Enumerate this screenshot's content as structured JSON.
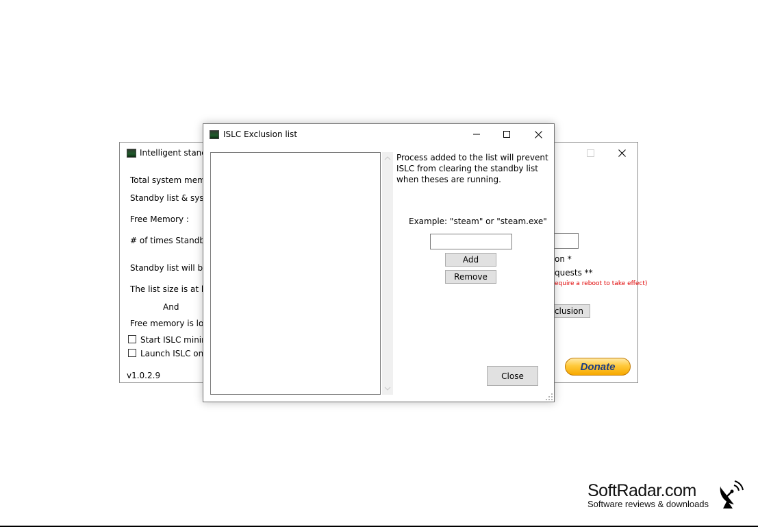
{
  "main_window": {
    "title": "Intelligent standb",
    "labels": {
      "total_memory": "Total system memor",
      "standby_list": "Standby list & syster",
      "free_memory": "Free Memory :",
      "times_standby": "# of times Standby l",
      "standby_will_be": "Standby list will be p",
      "list_size": "The list size is at leas",
      "and": "And",
      "free_lower": "Free memory is lowe",
      "start_minimized": "Start ISLC minimiz",
      "launch_on": "Launch ISLC on u",
      "version": "v1.0.2.9",
      "right_on": "on *",
      "right_requests": "quests **",
      "reboot_note": "equire a reboot to take effect)",
      "exclusion_button": "xclusion",
      "donate": "Donate"
    }
  },
  "dialog": {
    "title": "ISLC Exclusion list",
    "description_line1": "Process added to the list will prevent",
    "description_line2": "ISLC from clearing the standby list",
    "description_line3": "when theses are running.",
    "example": "Example: \"steam\" or \"steam.exe\"",
    "input_value": "",
    "add_label": "Add",
    "remove_label": "Remove",
    "close_label": "Close"
  },
  "branding": {
    "name": "SoftRadar.com",
    "tagline": "Software reviews & downloads"
  }
}
